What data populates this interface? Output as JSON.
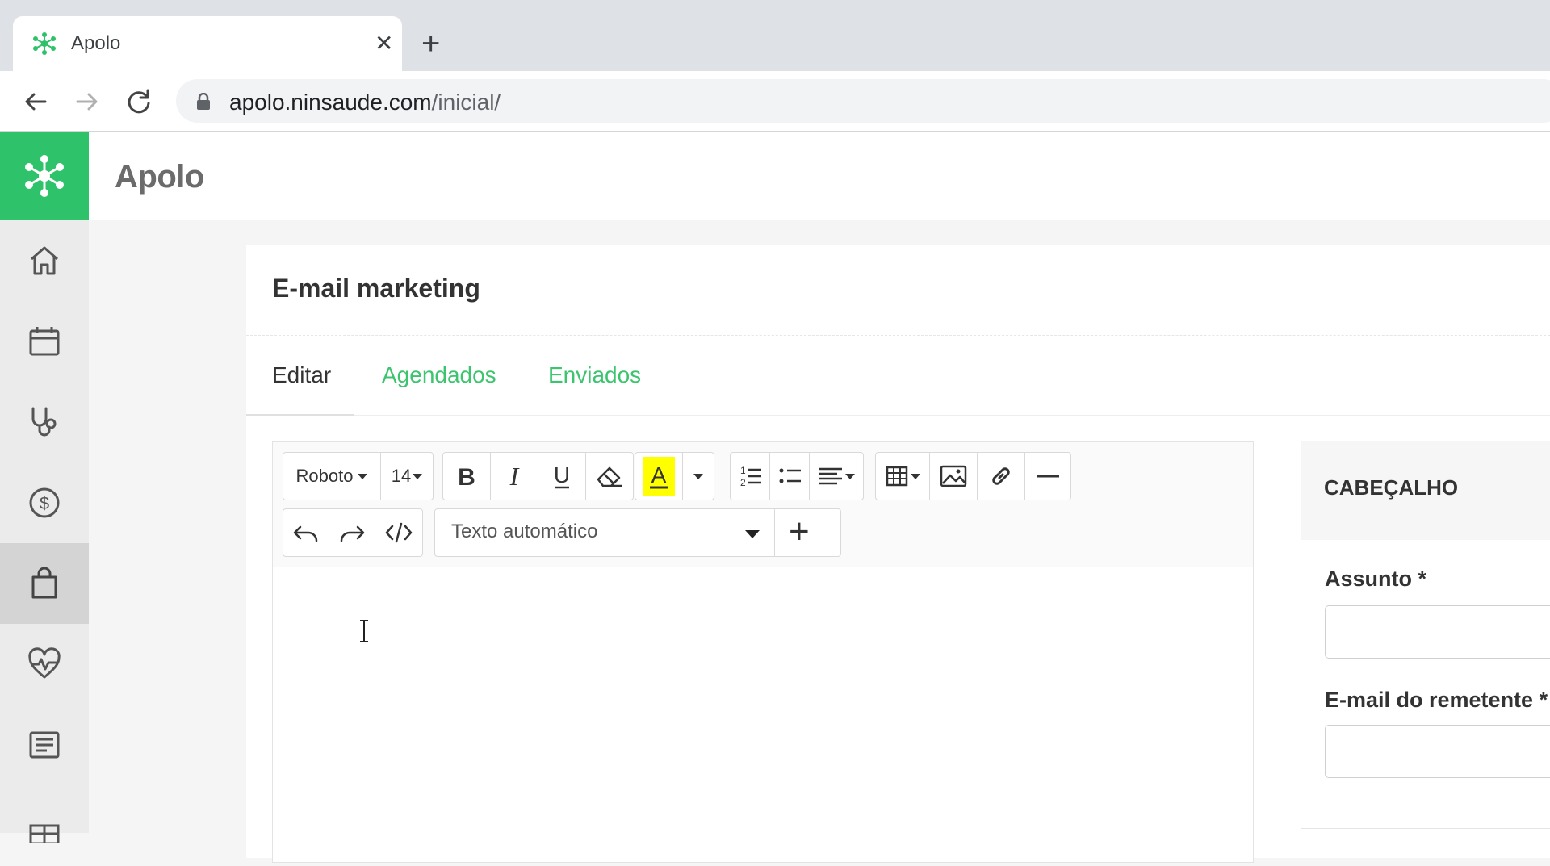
{
  "browser": {
    "tab_title": "Apolo",
    "close_glyph": "✕",
    "new_tab_glyph": "+",
    "url_host": "apolo.ninsaude.com",
    "url_path": "/inicial/"
  },
  "app": {
    "title": "Apolo",
    "brand_color": "#2ec26a",
    "sidebar_items": [
      "home-icon",
      "calendar-icon",
      "stethoscope-icon",
      "dollar-icon",
      "shopping-bag-icon",
      "heart-pulse-icon",
      "report-icon",
      "grid-icon"
    ],
    "sidebar_active": "shopping-bag-icon"
  },
  "card": {
    "title": "E-mail marketing",
    "tabs": [
      {
        "label": "Editar",
        "active": true
      },
      {
        "label": "Agendados",
        "active": false
      },
      {
        "label": "Enviados",
        "active": false
      }
    ]
  },
  "editor": {
    "font_family": "Roboto",
    "font_size": "14",
    "highlight_color": "#ffff00",
    "auto_text_select": "Texto automático",
    "add_glyph": "+",
    "toolbar_icons": [
      "bold-icon",
      "italic-icon",
      "underline-icon",
      "eraser-icon",
      "font-color-icon",
      "ordered-list-icon",
      "unordered-list-icon",
      "align-icon",
      "table-icon",
      "image-icon",
      "link-icon",
      "horizontal-rule-icon",
      "undo-icon",
      "redo-icon",
      "code-view-icon"
    ]
  },
  "form": {
    "section_header": "CABEÇALHO",
    "subject_label": "Assunto *",
    "sender_email_label": "E-mail do remetente *"
  }
}
